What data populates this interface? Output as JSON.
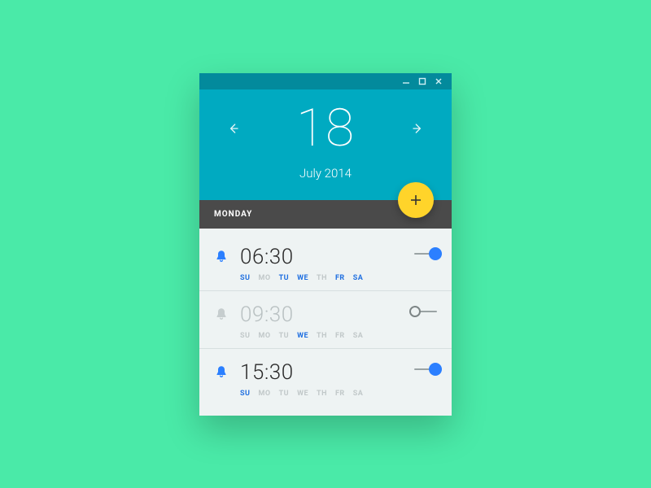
{
  "header": {
    "day": "18",
    "month_year": "July 2014"
  },
  "weekday_label": "MONDAY",
  "day_abbrevs": [
    "SU",
    "MO",
    "TU",
    "WE",
    "TH",
    "FR",
    "SA"
  ],
  "alarms": [
    {
      "time": "06:30",
      "enabled": true,
      "active_days": [
        0,
        2,
        3,
        5,
        6
      ]
    },
    {
      "time": "09:30",
      "enabled": false,
      "active_days": [
        3
      ]
    },
    {
      "time": "15:30",
      "enabled": true,
      "active_days": [
        0
      ]
    }
  ],
  "colors": {
    "accent": "#2b7fff",
    "fab": "#ffd42a",
    "header": "#00aac1",
    "titlebar": "#038a9c"
  }
}
